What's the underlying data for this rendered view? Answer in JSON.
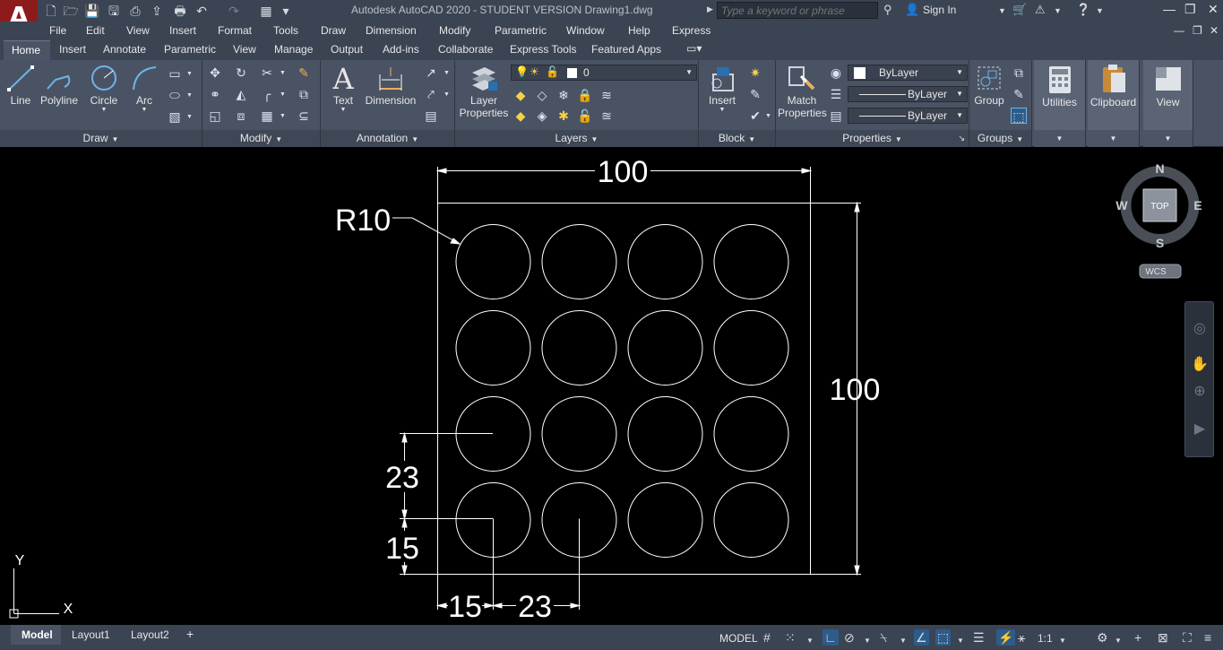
{
  "titlebar": {
    "window_title": "Autodesk AutoCAD 2020 - STUDENT VERSION    Drawing1.dwg",
    "search_placeholder": "Type a keyword or phrase",
    "sign_in": "Sign In"
  },
  "menu": [
    "File",
    "Edit",
    "View",
    "Insert",
    "Format",
    "Tools",
    "Draw",
    "Dimension",
    "Modify",
    "Parametric",
    "Window",
    "Help",
    "Express"
  ],
  "ribbon_tabs": [
    "Home",
    "Insert",
    "Annotate",
    "Parametric",
    "View",
    "Manage",
    "Output",
    "Add-ins",
    "Collaborate",
    "Express Tools",
    "Featured Apps"
  ],
  "panels": {
    "draw": {
      "title": "Draw",
      "line": "Line",
      "polyline": "Polyline",
      "circle": "Circle",
      "arc": "Arc"
    },
    "modify": {
      "title": "Modify"
    },
    "annotation": {
      "title": "Annotation",
      "text": "Text",
      "dimension": "Dimension"
    },
    "layers": {
      "title": "Layers",
      "layer_properties_1": "Layer",
      "layer_properties_2": "Properties",
      "current_layer": "0"
    },
    "block": {
      "title": "Block",
      "insert": "Insert"
    },
    "properties": {
      "title": "Properties",
      "match_1": "Match",
      "match_2": "Properties",
      "color": "ByLayer",
      "linetype": "ByLayer",
      "lineweight": "ByLayer"
    },
    "groups": {
      "title": "Groups",
      "group": "Group"
    },
    "utilities": "Utilities",
    "clipboard": "Clipboard",
    "view": "View"
  },
  "drawing": {
    "dim_width": "100",
    "dim_height": "100",
    "dim_radius": "R10",
    "dim_y_spacing": "23",
    "dim_y_offset": "15",
    "dim_x_offset": "15",
    "dim_x_spacing": "23",
    "grid_rows": 4,
    "grid_cols": 4
  },
  "viewcube": {
    "north": "N",
    "south": "S",
    "east": "E",
    "west": "W",
    "face": "TOP",
    "wcs": "WCS"
  },
  "ucs": {
    "x": "X",
    "y": "Y"
  },
  "layout_tabs": {
    "model": "Model",
    "layout1": "Layout1",
    "layout2": "Layout2",
    "add": "+"
  },
  "status": {
    "model": "MODEL",
    "scale": "1:1"
  },
  "colors": {
    "canvas": "#000000",
    "ribbon": "#4a5363",
    "titlebar": "#3b4453",
    "logo": "#8e1b1b",
    "geometry": "#ffffff"
  }
}
